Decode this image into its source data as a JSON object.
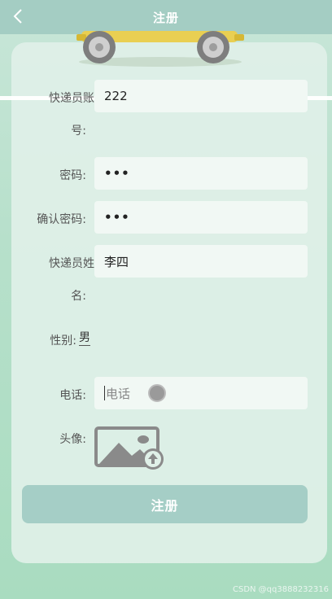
{
  "nav": {
    "title": "注册",
    "back_icon": "chevron-left-icon"
  },
  "form": {
    "account": {
      "label_line1": "快递员账",
      "label_line2": "号:",
      "value": "222"
    },
    "password": {
      "label": "密码:",
      "value": "•••"
    },
    "confirm_password": {
      "label": "确认密码:",
      "value": "•••"
    },
    "name": {
      "label_line1": "快递员姓",
      "label_line2": "名:",
      "value": "李四"
    },
    "gender": {
      "label": "性别:",
      "value": "男"
    },
    "phone": {
      "label": "电话:",
      "placeholder": "电话"
    },
    "avatar": {
      "label": "头像:",
      "icon": "image-upload-icon"
    },
    "submit_label": "注册"
  },
  "watermark": "CSDN @qq3888232316",
  "colors": {
    "header": "#a4cdc3",
    "button": "#a5cec6",
    "card": "#e0f0e8"
  }
}
